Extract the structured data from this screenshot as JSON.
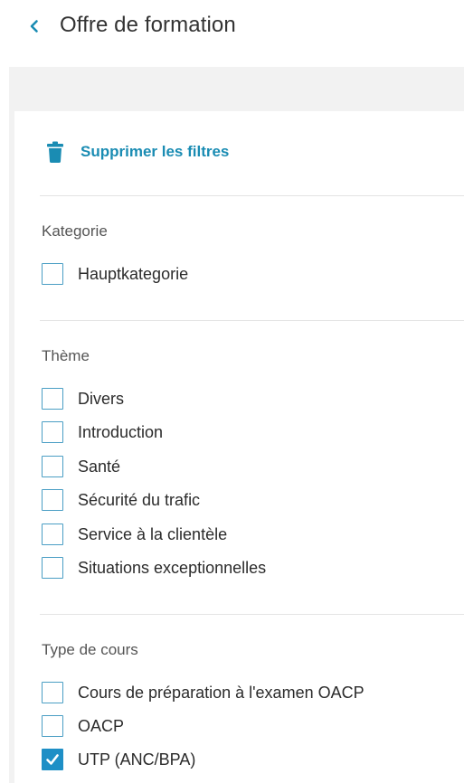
{
  "header": {
    "title": "Offre de formation",
    "back_icon": "chevron-left-icon"
  },
  "filters": {
    "clear_label": "Supprimer les filtres",
    "clear_icon": "trash-icon",
    "accent_color": "#1a8cb3",
    "groups": [
      {
        "title": "Kategorie",
        "options": [
          {
            "label": "Hauptkategorie",
            "checked": false
          }
        ]
      },
      {
        "title": "Thème",
        "options": [
          {
            "label": "Divers",
            "checked": false
          },
          {
            "label": "Introduction",
            "checked": false
          },
          {
            "label": "Santé",
            "checked": false
          },
          {
            "label": "Sécurité du trafic",
            "checked": false
          },
          {
            "label": "Service à la clientèle",
            "checked": false
          },
          {
            "label": "Situations exceptionnelles",
            "checked": false
          }
        ]
      },
      {
        "title": "Type de cours",
        "options": [
          {
            "label": "Cours de préparation à l'examen OACP",
            "checked": false
          },
          {
            "label": "OACP",
            "checked": false
          },
          {
            "label": "UTP (ANC/BPA)",
            "checked": true
          }
        ]
      }
    ]
  }
}
